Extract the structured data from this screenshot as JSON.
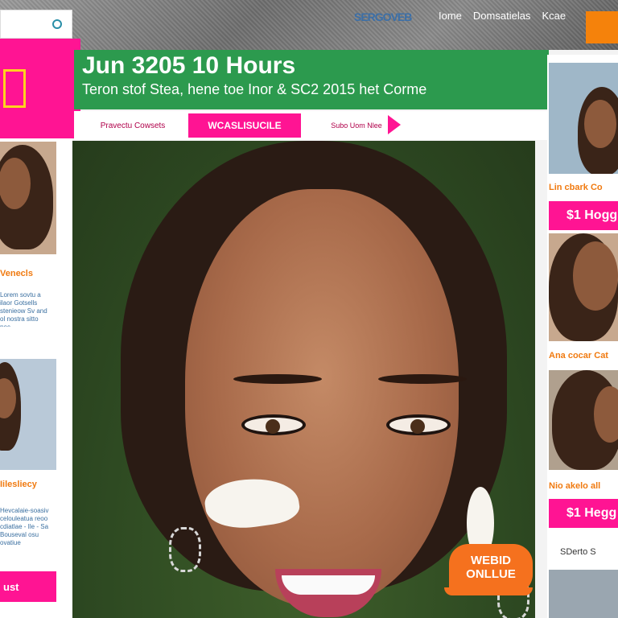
{
  "search": {
    "icon": "search-icon"
  },
  "header": {
    "logo_text": "SERGOVEB",
    "links": [
      "Iome",
      "Domsatielas",
      "Kcae"
    ]
  },
  "banner": {
    "title": "Jun 3205 10 Hours",
    "subtitle": "Teron stof Stea, hene toe Inor & SC2 2015 het Corme"
  },
  "tabs": [
    {
      "label": "Pravectu Cowsets"
    },
    {
      "label": "WCASLISUCILE"
    },
    {
      "label": "Subo Uom Nlee"
    }
  ],
  "left_sidebar": {
    "items": [
      {
        "label": "Venecls",
        "text": "Lorem sovtu a ilaor Gotsells stenieow Sv and ol nostra sitto nec"
      },
      {
        "label": "Iilesliecy",
        "text": "Hevcalaie-soasiv celouleatua reoo cdiatlae - Ile - Sa Bouseval osu ovatiue"
      }
    ],
    "button_label": "ust"
  },
  "right_sidebar": {
    "items": [
      {
        "label": "Lin cbark Co",
        "button": "$1 Hogg"
      },
      {
        "label": "Ana cocar Cat",
        "button": ""
      },
      {
        "label": "Nio akelo all",
        "button": "$1 Hegg S"
      }
    ],
    "footer_text": "SDerto   S"
  },
  "hero": {
    "badge_line1": "WEBID",
    "badge_line2": "ONLLUE"
  },
  "colors": {
    "pink": "#ff1493",
    "green": "#2c9a4e",
    "orange": "#f5820b"
  }
}
